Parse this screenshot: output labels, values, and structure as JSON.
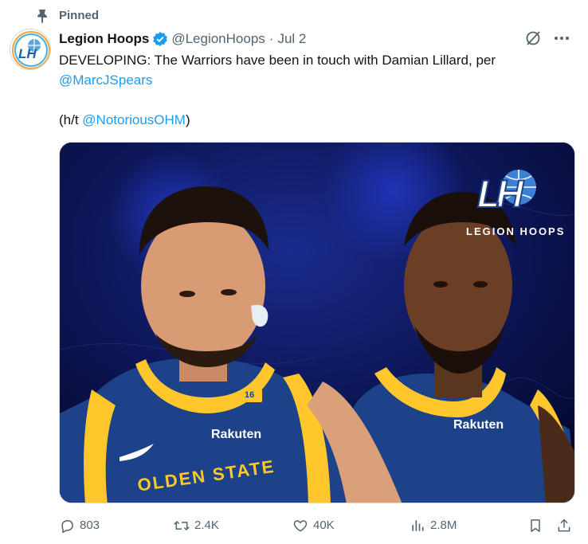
{
  "pinned": {
    "label": "Pinned",
    "icon": "pin-icon"
  },
  "tweet": {
    "author": {
      "display_name": "Legion Hoops",
      "handle": "@LegionHoops",
      "verified_icon": "verified-badge-icon",
      "avatar_icon": "legion-hoops-logo"
    },
    "separator": "·",
    "date": "Jul 2",
    "header_icons": [
      "grok-icon",
      "more-icon"
    ],
    "text": {
      "line1": "DEVELOPING: The Warriors have been in touch with Damian Lillard, per",
      "mention1": "@MarcJSpears",
      "ht_prefix": "(h/t ",
      "mention2": "@NotoriousOHM",
      "ht_suffix": ")"
    },
    "media": {
      "brand_logo": "LH",
      "brand_name": "LEGION HOOPS",
      "jersey_sponsor": "Rakuten",
      "jersey_sponsor_2": "Rakuten",
      "jersey_text": "OLDEN STATE",
      "jersey_number": "16"
    },
    "stats": {
      "replies": "803",
      "reposts": "2.4K",
      "likes": "40K",
      "views": "2.8M"
    }
  },
  "colors": {
    "accent": "#1d9bf0",
    "muted": "#536471",
    "text": "#0f1419",
    "warriors_blue": "#1d428a",
    "warriors_gold": "#ffc72c"
  }
}
